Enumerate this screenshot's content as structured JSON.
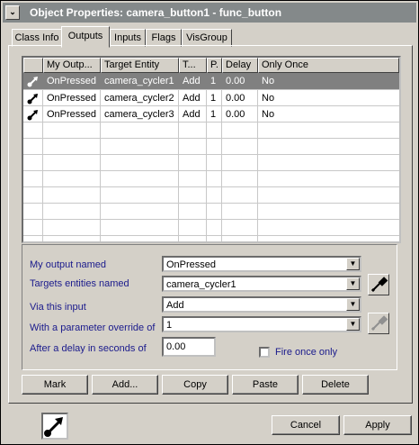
{
  "window": {
    "title": "Object Properties: camera_button1 - func_button",
    "sys_icon": "collapse-icon"
  },
  "tabs": [
    {
      "label": "Class Info",
      "active": false
    },
    {
      "label": "Outputs",
      "active": true
    },
    {
      "label": "Inputs",
      "active": false
    },
    {
      "label": "Flags",
      "active": false
    },
    {
      "label": "VisGroup",
      "active": false
    }
  ],
  "outputs_list": {
    "columns": [
      "",
      "My Outp...",
      "Target Entity",
      "T...",
      "P.",
      "Delay",
      "Only Once"
    ],
    "rows": [
      {
        "icon": "output-connection-icon",
        "output": "OnPressed",
        "target": "camera_cycler1",
        "input": "Add",
        "param": "1",
        "delay": "0.00",
        "only_once": "No",
        "selected": true
      },
      {
        "icon": "output-connection-icon",
        "output": "OnPressed",
        "target": "camera_cycler2",
        "input": "Add",
        "param": "1",
        "delay": "0.00",
        "only_once": "No",
        "selected": false
      },
      {
        "icon": "output-connection-icon",
        "output": "OnPressed",
        "target": "camera_cycler3",
        "input": "Add",
        "param": "1",
        "delay": "0.00",
        "only_once": "No",
        "selected": false
      }
    ]
  },
  "editor": {
    "output_label": "My output named",
    "output_value": "OnPressed",
    "target_label": "Targets entities named",
    "target_value": "camera_cycler1",
    "input_label": "Via this input",
    "input_value": "Add",
    "param_label": "With a parameter override of",
    "param_value": "1",
    "delay_label": "After a delay in seconds of",
    "delay_value": "0.00",
    "fire_once_label": "Fire once only",
    "fire_once_checked": false,
    "eyedropper_icon": "eyedropper-icon"
  },
  "actions": {
    "mark": "Mark",
    "add": "Add...",
    "copy": "Copy",
    "paste": "Paste",
    "delete": "Delete"
  },
  "footer": {
    "cancel": "Cancel",
    "apply": "Apply",
    "entity_icon": "output-connection-icon"
  }
}
